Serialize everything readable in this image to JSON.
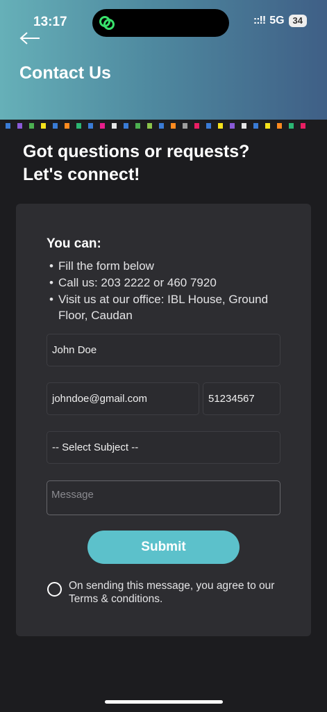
{
  "status_bar": {
    "time": "13:17",
    "signal": "::!!",
    "network": "5G",
    "battery": "34"
  },
  "header": {
    "title": "Contact Us",
    "back_icon": "arrow-left-icon",
    "accent_dots": [
      "#3a7bd5",
      "#8a5ad8",
      "#4caf50",
      "#f5e21b",
      "#3a7bd5",
      "#ff8a1f",
      "#2bb673",
      "#3a7bd5",
      "#e91e8c",
      "#e5e5e5",
      "#3a7bd5",
      "#4caf50",
      "#8bc34a",
      "#3a7bd5",
      "#ff8a1f",
      "#9e9e9e",
      "#e91e63",
      "#3a7bd5",
      "#f5e21b",
      "#8a5ad8",
      "#e5e5e5",
      "#3a7bd5",
      "#f5e21b",
      "#ff8a1f",
      "#2bb673",
      "#e91e63"
    ]
  },
  "headline": {
    "line1": "Got questions or requests?",
    "line2": "Let's connect!"
  },
  "card": {
    "you_can": "You can:",
    "bullets": [
      "Fill the form below",
      "Call us: 203 2222 or 460 7920",
      "Visit us at our office: IBL House, Ground Floor, Caudan"
    ]
  },
  "form": {
    "name_value": "John Doe",
    "email_value": "johndoe@gmail.com",
    "phone_value": "51234567",
    "subject_value": "-- Select Subject --",
    "message_placeholder": "Message",
    "submit_label": "Submit",
    "consent_text": "On sending this message, you agree to our Terms & conditions."
  },
  "colors": {
    "accent": "#5cc1cb",
    "background": "#1c1c1f",
    "card": "#2d2d31"
  }
}
